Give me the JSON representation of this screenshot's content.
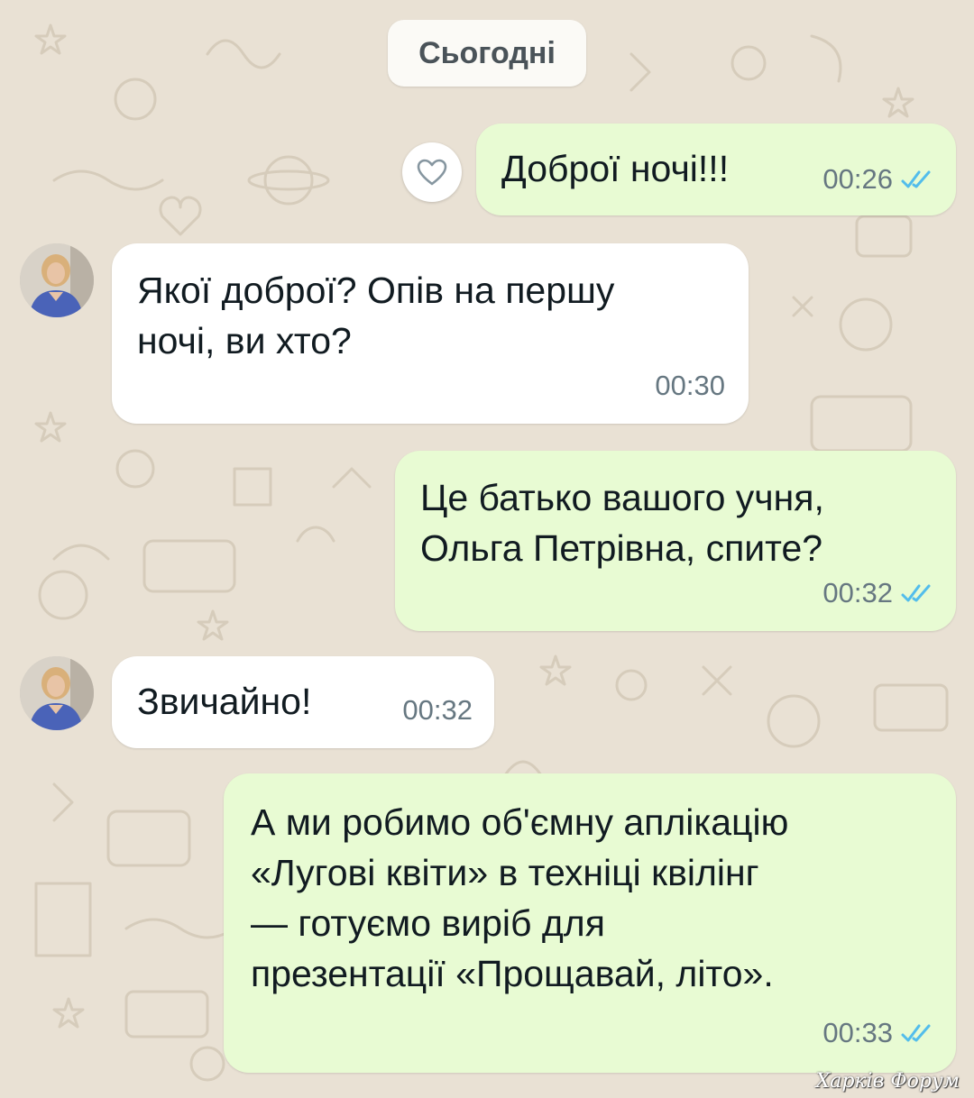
{
  "chat": {
    "date_label": "Сьогодні",
    "messages": [
      {
        "direction": "out",
        "text": "Доброї ночі!!!",
        "time": "00:26",
        "status_icon": "double-check-read-icon"
      },
      {
        "direction": "in",
        "text": "Якої доброї? Опів на першу\nночі, ви хто?",
        "time": "00:30"
      },
      {
        "direction": "out",
        "text": "Це батько вашого учня,\nОльга Петрівна, спите?",
        "time": "00:32",
        "status_icon": "double-check-read-icon"
      },
      {
        "direction": "in",
        "text": "Звичайно!",
        "time": "00:32"
      },
      {
        "direction": "out",
        "text": "А ми робимо об'ємну аплікацію\n«Лугові квіти» в техніці квілінг\n— готуємо виріб для\nпрезентації «Прощавай, літо».",
        "time": "00:33",
        "status_icon": "double-check-read-icon"
      }
    ],
    "reaction_icon": "heart-outline-icon"
  },
  "watermark": "Харків Форум",
  "colors": {
    "wallpaper": "#e9e1d4",
    "outgoing_bubble": "#e8fbd3",
    "incoming_bubble": "#ffffff",
    "read_ticks": "#53bdeb",
    "meta_text": "#667781"
  }
}
